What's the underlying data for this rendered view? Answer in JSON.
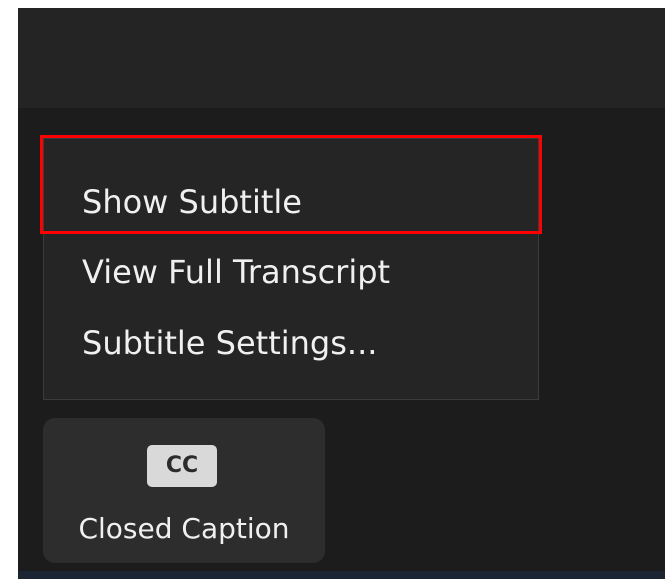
{
  "menu": {
    "items": [
      {
        "label": "Show Subtitle"
      },
      {
        "label": "View Full Transcript"
      },
      {
        "label": "Subtitle Settings..."
      }
    ]
  },
  "toolbar": {
    "closed_caption": {
      "icon_text": "CC",
      "label": "Closed Caption"
    }
  },
  "colors": {
    "background": "#1c1c1c",
    "menu_background": "#252525",
    "highlight": "#ff0000",
    "text": "#f0f0f0"
  }
}
